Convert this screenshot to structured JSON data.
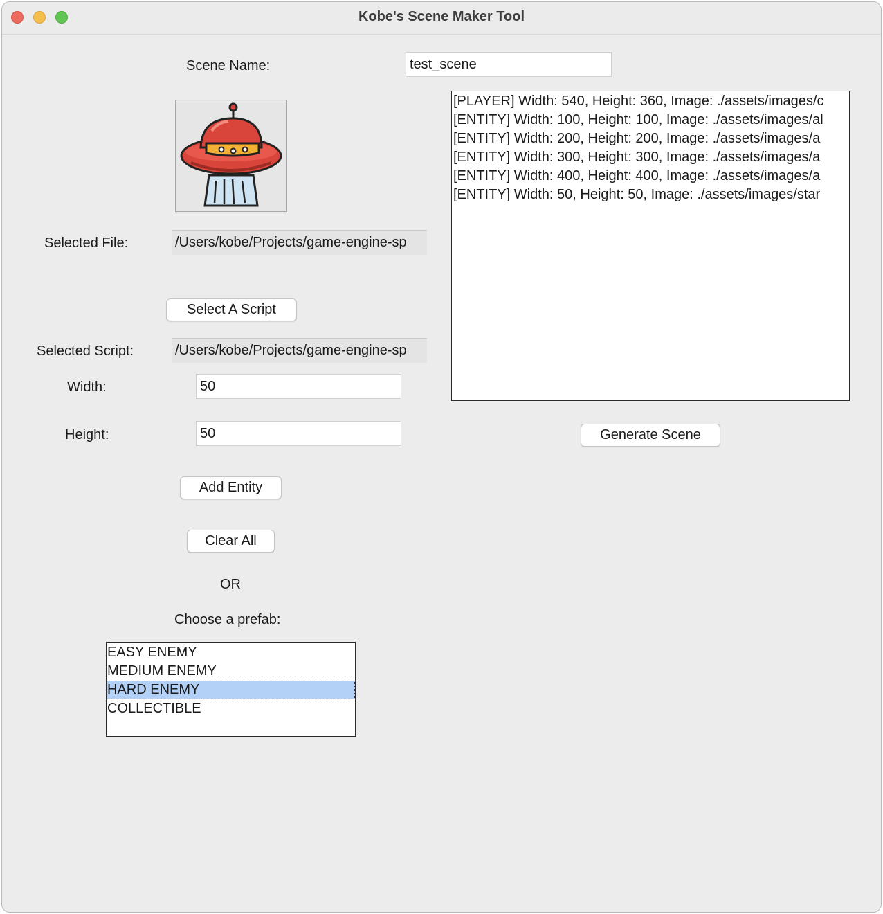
{
  "window": {
    "title": "Kobe's Scene Maker Tool"
  },
  "form": {
    "scene_name_label": "Scene Name:",
    "scene_name_value": "test_scene",
    "preview_icon": "ufo-image",
    "selected_file_label": "Selected File:",
    "selected_file_value": "/Users/kobe/Projects/game-engine-sp",
    "select_script_button": "Select A Script",
    "selected_script_label": "Selected Script:",
    "selected_script_value": "/Users/kobe/Projects/game-engine-sp",
    "width_label": "Width:",
    "width_value": "50",
    "height_label": "Height:",
    "height_value": "50",
    "add_entity_button": "Add Entity",
    "clear_all_button": "Clear All",
    "or_label": "OR",
    "prefab_label": "Choose a prefab:"
  },
  "prefabs": {
    "items": [
      "EASY ENEMY",
      "MEDIUM ENEMY",
      "HARD ENEMY",
      "COLLECTIBLE"
    ],
    "selected": "HARD ENEMY"
  },
  "entities": {
    "lines": [
      "[PLAYER] Width: 540, Height: 360, Image: ./assets/images/c",
      "[ENTITY] Width: 100, Height: 100, Image: ./assets/images/al",
      "[ENTITY] Width: 200, Height: 200, Image: ./assets/images/a",
      "[ENTITY] Width: 300, Height: 300, Image: ./assets/images/a",
      "[ENTITY] Width: 400, Height: 400, Image: ./assets/images/a",
      "[ENTITY] Width: 50, Height: 50, Image: ./assets/images/star"
    ]
  },
  "actions": {
    "generate_scene_button": "Generate Scene"
  },
  "colors": {
    "selection": "#b3d1f6",
    "ufo_red": "#d9453a",
    "ufo_band": "#f2b134",
    "beam": "#cfe4f2"
  }
}
